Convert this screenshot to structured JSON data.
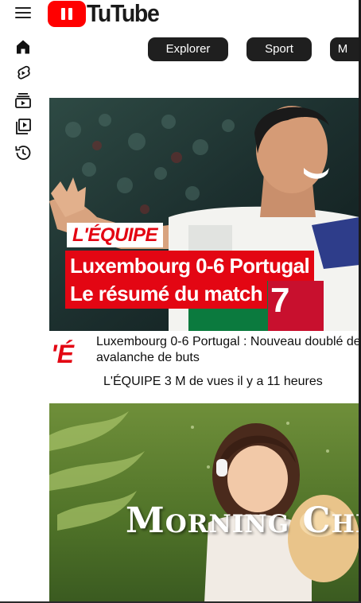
{
  "header": {
    "logo_text": "TuTube",
    "menu_icon": "hamburger-menu-icon",
    "logo_icon": "play-logo-icon",
    "brand_color": "#ff0000"
  },
  "sidebar": {
    "items": [
      {
        "icon": "home-icon"
      },
      {
        "icon": "shorts-icon"
      },
      {
        "icon": "subscriptions-icon"
      },
      {
        "icon": "library-icon"
      },
      {
        "icon": "history-icon"
      }
    ]
  },
  "chips": [
    {
      "label": "Explorer"
    },
    {
      "label": "Sport"
    },
    {
      "label": "M"
    }
  ],
  "videos": [
    {
      "thumbnail": {
        "brand": "L'ÉQUIPE",
        "headline_line1": "Luxembourg 0-6 Portugal",
        "headline_line2": "Le résumé du match",
        "jersey_number": "7"
      },
      "channel_logo": "'É",
      "title_line1": "Luxembourg 0-6 Portugal : Nouveau doublé de",
      "title_line2": "avalanche de buts",
      "meta": "L'ÉQUIPE 3 M de vues il y a 11 heures"
    },
    {
      "thumbnail": {
        "overlay_text": "Morning Chill Vib"
      }
    }
  ],
  "colors": {
    "chip_bg": "#1f1f1f",
    "equipe_red": "#e30613"
  }
}
